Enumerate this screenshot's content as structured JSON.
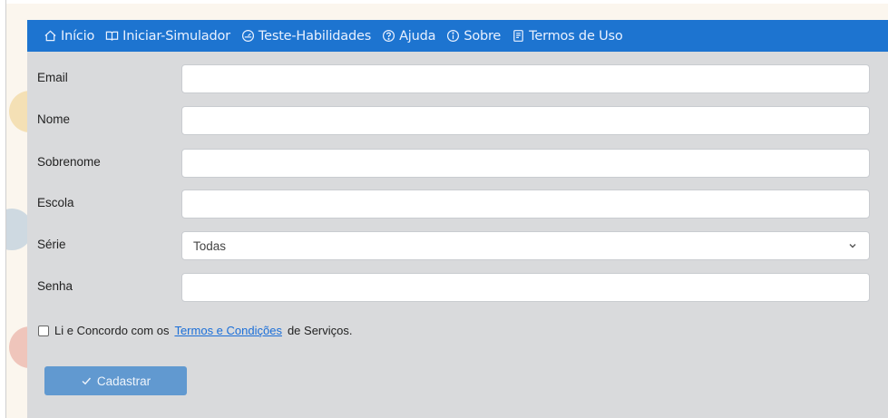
{
  "nav": {
    "items": [
      {
        "label": "Início",
        "icon": "home-icon"
      },
      {
        "label": "Iniciar-Simulador",
        "icon": "book-icon"
      },
      {
        "label": "Teste-Habilidades",
        "icon": "gauge-icon"
      },
      {
        "label": "Ajuda",
        "icon": "help-circle-icon"
      },
      {
        "label": "Sobre",
        "icon": "info-circle-icon"
      },
      {
        "label": "Termos de Uso",
        "icon": "document-icon"
      }
    ]
  },
  "form": {
    "email": {
      "label": "Email",
      "value": ""
    },
    "nome": {
      "label": "Nome",
      "value": ""
    },
    "sobrenome": {
      "label": "Sobrenome",
      "value": ""
    },
    "escola": {
      "label": "Escola",
      "value": ""
    },
    "serie": {
      "label": "Série",
      "selected": "Todas"
    },
    "senha": {
      "label": "Senha",
      "value": ""
    },
    "terms": {
      "prefix": "Li e Concordo com os",
      "link": "Termos e Condições",
      "suffix": "de Serviços."
    },
    "submit_label": "Cadastrar"
  },
  "colors": {
    "navbar": "#1d74d0",
    "panel": "#d9dadc",
    "button": "#6199d0",
    "link": "#1a6ed8"
  }
}
